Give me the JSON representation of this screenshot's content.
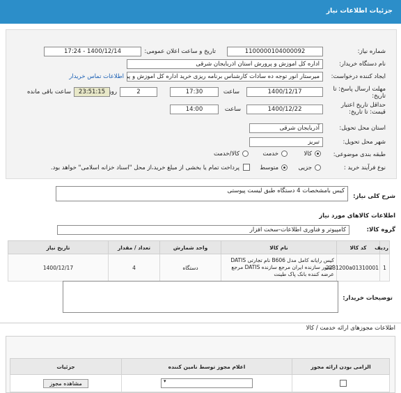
{
  "header": {
    "title": "جزئیات اطلاعات نیاز"
  },
  "form": {
    "need_number_label": "شماره نیاز:",
    "need_number": "1100000104000092",
    "announce_label": "تاریخ و ساعت اعلان عمومی:",
    "announce_value": "1400/12/14 - 17:24",
    "buyer_org_label": "نام دستگاه خریدار:",
    "buyer_org": "اداره کل اموزش و پرورش استان اذربایجان شرقی",
    "creator_label": "ایجاد کننده درخواست:",
    "creator": "میرستار انور توجه ده سادات کارشناس برنامه ریزی خرید اداره کل اموزش و پرورش",
    "contact_link": "اطلاعات تماس خریدار",
    "send_deadline_label": "مهلت ارسال پاسخ: تا تاریخ:",
    "send_date": "1400/12/17",
    "time_label": "ساعت",
    "send_time": "17:30",
    "days": "2",
    "days_label": "روز و",
    "remaining": "23:51:15",
    "remaining_label": "ساعت باقی مانده",
    "min_valid_label": "حداقل تاریخ اعتبار قیمت: تا تاریخ:",
    "valid_date": "1400/12/22",
    "valid_time_label": "ساعت",
    "valid_time": "14:00",
    "province_label": "استان محل تحویل:",
    "province": "آذربایجان شرقی",
    "city_label": "شهر محل تحویل:",
    "city": "تبریز",
    "category_label": "طبقه بندی موضوعی:",
    "category_options": [
      "کالا",
      "خدمت",
      "کالا/خدمت"
    ],
    "process_label": "نوع فرآیند خرید :",
    "process_options": [
      "جزیی",
      "متوسط"
    ],
    "payment_note": "پرداخت تمام یا بخشی از مبلغ خرید،از محل \"اسناد خزانه اسلامی\" خواهد بود."
  },
  "summary": {
    "label": "شرح کلی نیاز:",
    "value": "کیس بامشخصات 4 دستگاه طبق لیست پیوستی"
  },
  "goods_section": {
    "title": "اطلاعات کالاهای مورد نیاز",
    "group_label": "گروه کالا:",
    "group_value": "کامپیوتر و فناوری اطلاعات-سخت افزار"
  },
  "table": {
    "headers": [
      "ردیف",
      "کد کالا",
      "نام کالا",
      "واحد شمارش",
      "تعداد / مقدار",
      "تاریخ نیاز"
    ],
    "rows": [
      {
        "row": "1",
        "code": "2231200a01310001",
        "name": "کیس رایانه کامل مدل B606 نام تجارتی DATIS کشور سازنده ایران مرجع سازنده DATIS مرجع عرضه کننده بانک پاک طینت",
        "unit": "دستگاه",
        "qty": "4",
        "date": "1400/12/17"
      }
    ]
  },
  "buyer_notes_label": "توضیحات خریدار:",
  "license_section": {
    "title": "اطلاعات مجوزهای ارائه خدمت / کالا",
    "headers": [
      "الزامی بودن ارائه مجوز",
      "اعلام مجوز توسط نامین کننده",
      "جزئیات"
    ],
    "view_button": "مشاهده مجوز"
  }
}
